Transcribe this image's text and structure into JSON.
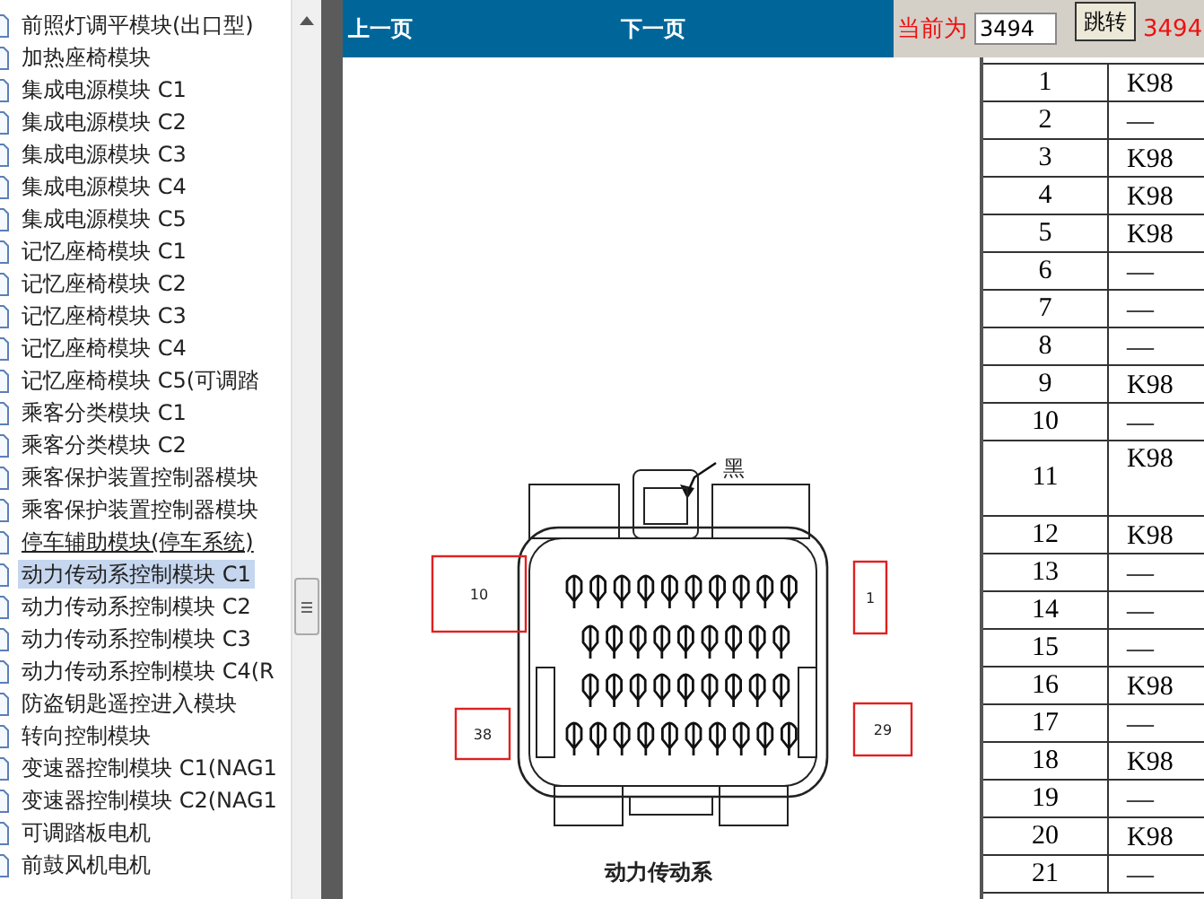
{
  "sidebar": {
    "items": [
      {
        "label": "前照灯调平模块(出口型)",
        "selected": false,
        "underlined": false
      },
      {
        "label": "加热座椅模块",
        "selected": false,
        "underlined": false
      },
      {
        "label": "集成电源模块 C1",
        "selected": false,
        "underlined": false
      },
      {
        "label": "集成电源模块 C2",
        "selected": false,
        "underlined": false
      },
      {
        "label": "集成电源模块 C3",
        "selected": false,
        "underlined": false
      },
      {
        "label": "集成电源模块 C4",
        "selected": false,
        "underlined": false
      },
      {
        "label": "集成电源模块 C5",
        "selected": false,
        "underlined": false
      },
      {
        "label": "记忆座椅模块 C1",
        "selected": false,
        "underlined": false
      },
      {
        "label": "记忆座椅模块 C2",
        "selected": false,
        "underlined": false
      },
      {
        "label": "记忆座椅模块 C3",
        "selected": false,
        "underlined": false
      },
      {
        "label": "记忆座椅模块 C4",
        "selected": false,
        "underlined": false
      },
      {
        "label": "记忆座椅模块 C5(可调踏",
        "selected": false,
        "underlined": false
      },
      {
        "label": "乘客分类模块 C1",
        "selected": false,
        "underlined": false
      },
      {
        "label": "乘客分类模块 C2",
        "selected": false,
        "underlined": false
      },
      {
        "label": "乘客保护装置控制器模块",
        "selected": false,
        "underlined": false
      },
      {
        "label": "乘客保护装置控制器模块",
        "selected": false,
        "underlined": false
      },
      {
        "label": "停车辅助模块(停车系统)",
        "selected": false,
        "underlined": true
      },
      {
        "label": "动力传动系控制模块 C1",
        "selected": true,
        "underlined": false
      },
      {
        "label": "动力传动系控制模块 C2",
        "selected": false,
        "underlined": false
      },
      {
        "label": "动力传动系控制模块 C3",
        "selected": false,
        "underlined": false
      },
      {
        "label": "动力传动系控制模块 C4(R",
        "selected": false,
        "underlined": false
      },
      {
        "label": "防盗钥匙遥控进入模块",
        "selected": false,
        "underlined": false
      },
      {
        "label": "转向控制模块",
        "selected": false,
        "underlined": false
      },
      {
        "label": "变速器控制模块 C1(NAG1",
        "selected": false,
        "underlined": false
      },
      {
        "label": "变速器控制模块 C2(NAG1",
        "selected": false,
        "underlined": false
      },
      {
        "label": "可调踏板电机",
        "selected": false,
        "underlined": false
      },
      {
        "label": "前鼓风机电机",
        "selected": false,
        "underlined": false
      }
    ]
  },
  "toolbar": {
    "prev": "上一页",
    "next": "下一页",
    "current_label": "当前为",
    "page_input": "3494",
    "jump_button": "跳转",
    "current_page": "3494"
  },
  "figure": {
    "callout": "黑",
    "pin_labels": [
      "10",
      "1",
      "38",
      "29"
    ],
    "caption": "动力传动系"
  },
  "table": {
    "rows": [
      {
        "pin": "1",
        "circuit": "K98",
        "tall": false
      },
      {
        "pin": "2",
        "circuit": "—",
        "tall": false
      },
      {
        "pin": "3",
        "circuit": "K98",
        "tall": false
      },
      {
        "pin": "4",
        "circuit": "K98",
        "tall": false
      },
      {
        "pin": "5",
        "circuit": "K98",
        "tall": false
      },
      {
        "pin": "6",
        "circuit": "—",
        "tall": false
      },
      {
        "pin": "7",
        "circuit": "—",
        "tall": false
      },
      {
        "pin": "8",
        "circuit": "—",
        "tall": false
      },
      {
        "pin": "9",
        "circuit": "K98",
        "tall": false
      },
      {
        "pin": "10",
        "circuit": "—",
        "tall": false
      },
      {
        "pin": "11",
        "circuit": "K98",
        "tall": true
      },
      {
        "pin": "12",
        "circuit": "K98",
        "tall": false
      },
      {
        "pin": "13",
        "circuit": "—",
        "tall": false
      },
      {
        "pin": "14",
        "circuit": "—",
        "tall": false
      },
      {
        "pin": "15",
        "circuit": "—",
        "tall": false
      },
      {
        "pin": "16",
        "circuit": "K98",
        "tall": false
      },
      {
        "pin": "17",
        "circuit": "—",
        "tall": false
      },
      {
        "pin": "18",
        "circuit": "K98",
        "tall": false
      },
      {
        "pin": "19",
        "circuit": "—",
        "tall": false
      },
      {
        "pin": "20",
        "circuit": "K98",
        "tall": false
      },
      {
        "pin": "21",
        "circuit": "—",
        "tall": false
      }
    ]
  }
}
